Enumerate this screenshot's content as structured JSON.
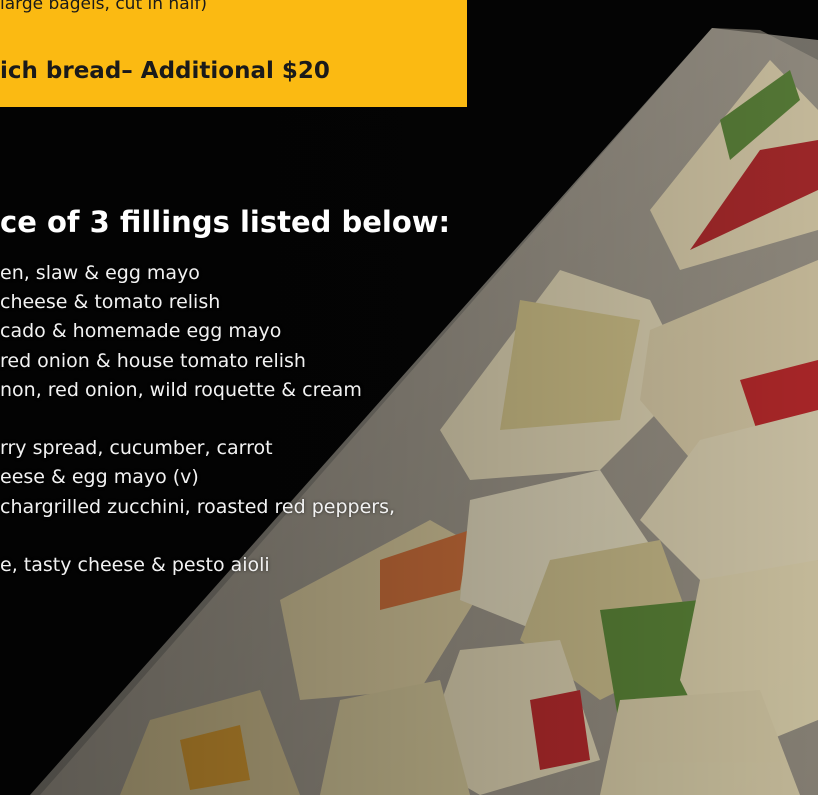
{
  "banner": {
    "line1": "large bagels, cut in half)",
    "line2": "ich bread– Additional $20"
  },
  "heading": "ce of 3 fillings listed below:",
  "fillings": [
    "en, slaw & egg mayo",
    "cheese & tomato relish",
    "cado & homemade egg mayo",
    "red onion & house tomato relish",
    "non, red onion, wild roquette & cream",
    "",
    "rry spread, cucumber, carrot",
    "eese & egg mayo (v)",
    "chargrilled zucchini, roasted red peppers,",
    "",
    "e, tasty cheese & pesto aioli"
  ],
  "colors": {
    "banner": "#fbba12",
    "background": "#050505",
    "text": "#ffffff",
    "banner_text": "#1a1a1a"
  },
  "icons": [
    "sandwich-platter-photo"
  ]
}
